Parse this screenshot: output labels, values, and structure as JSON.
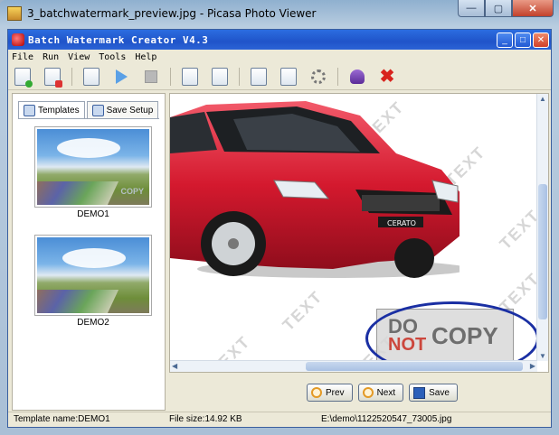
{
  "outer_window": {
    "title": "3_batchwatermark_preview.jpg - Picasa Photo Viewer",
    "buttons": {
      "minimize": "—",
      "maximize": "▢",
      "close": "✕"
    }
  },
  "app_window": {
    "title": "Batch Watermark Creator V4.3",
    "buttons": {
      "minimize": "_",
      "maximize": "□",
      "close": "✕"
    }
  },
  "menu": [
    "File",
    "Run",
    "View",
    "Tools",
    "Help"
  ],
  "toolbar": {
    "icons": [
      "new-file-icon",
      "delete-file-icon",
      "preview-icon",
      "run-icon",
      "stop-icon",
      "text-icon",
      "image-icon",
      "paste-icon",
      "search-icon",
      "gear-icon",
      "user-icon",
      "exit-icon"
    ]
  },
  "left_panel": {
    "tabs": [
      "Templates",
      "Save Setup"
    ],
    "templates": [
      {
        "label": "DEMO1",
        "watermark": "COPY"
      },
      {
        "label": "DEMO2"
      }
    ]
  },
  "preview": {
    "watermark_repeats": [
      "TEXT",
      "TEXT",
      "TEXT",
      "TEXT",
      "TEXT",
      "TEXT",
      "TEXT"
    ],
    "stamp": {
      "do": "DO",
      "not": "NOT",
      "copy": "COPY"
    },
    "car_badge": "CERATO",
    "scroll_symbols": {
      "up": "▲",
      "down": "▼",
      "left": "◀",
      "right": "▶"
    }
  },
  "buttons": {
    "prev": "Prev",
    "next": "Next",
    "save": "Save"
  },
  "status_bar": {
    "template": "Template name:DEMO1",
    "file_size": "File size:14.92 KB",
    "path": "E:\\demo\\1122520547_73005.jpg"
  },
  "colors": {
    "app_title": "#1f54c9",
    "ring": "#1a2fa3",
    "close_red": "#c2412b"
  }
}
